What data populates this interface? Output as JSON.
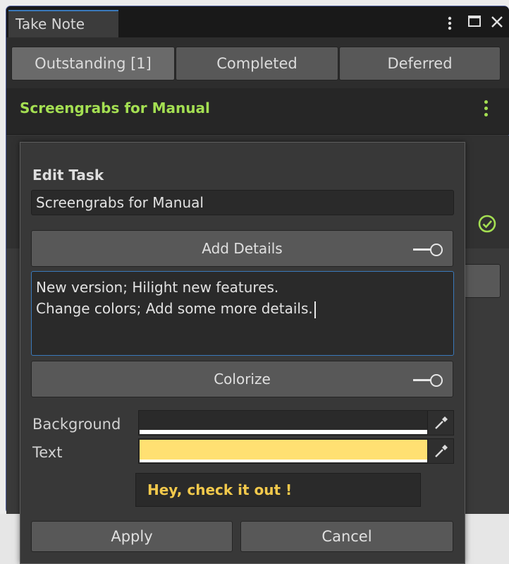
{
  "window": {
    "tab_title": "Take Note"
  },
  "filters": [
    {
      "label": "Outstanding [1]",
      "active": true
    },
    {
      "label": "Completed",
      "active": false
    },
    {
      "label": "Deferred",
      "active": false
    }
  ],
  "task": {
    "title": "Screengrabs for Manual",
    "title_color": "#a4df52"
  },
  "editor": {
    "heading": "Edit Task",
    "name_value": "Screengrabs for Manual",
    "add_details_label": "Add Details",
    "details_line1": "New version; Hilight new features.",
    "details_line2": "Change colors; Add some more details.",
    "colorize_label": "Colorize",
    "background_label": "Background",
    "background_color": "#ffffff",
    "text_label": "Text",
    "text_color": "#ffe072",
    "preview_text": "Hey, check it out !",
    "apply_label": "Apply",
    "cancel_label": "Cancel"
  },
  "icons": [
    "kebab-menu-icon",
    "maximize-icon",
    "close-icon",
    "check-circle-icon",
    "eyedropper-icon",
    "toggle-icon"
  ]
}
